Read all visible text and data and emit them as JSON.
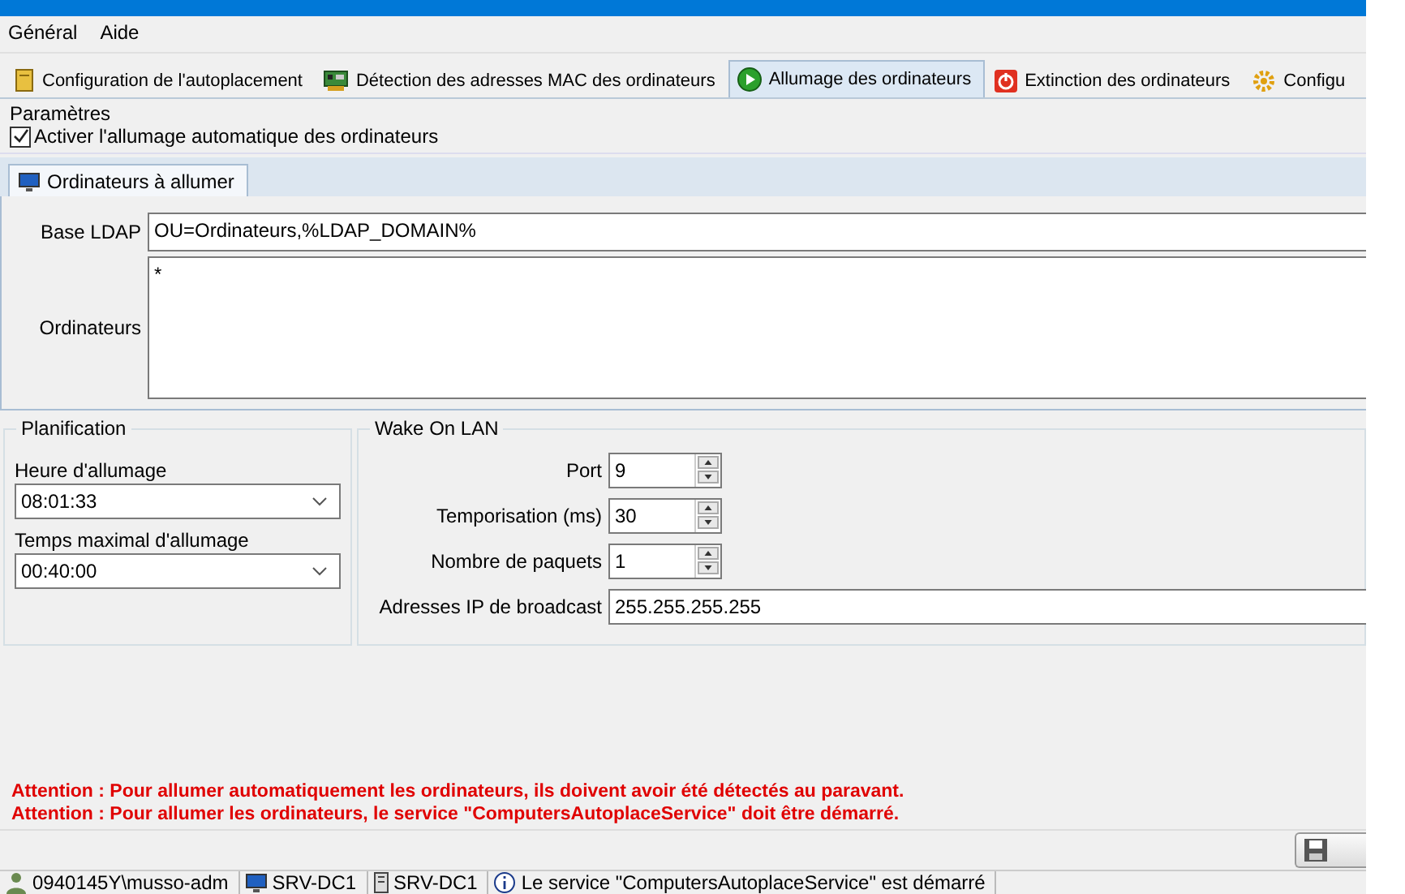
{
  "menu": [
    {
      "label": "Général"
    },
    {
      "label": "Aide"
    }
  ],
  "tabs": [
    {
      "label": "Configuration de l'autoplacement",
      "selected": false
    },
    {
      "label": "Détection des adresses MAC des ordinateurs",
      "selected": false
    },
    {
      "label": "Allumage des ordinateurs",
      "selected": true
    },
    {
      "label": "Extinction des ordinateurs",
      "selected": false
    },
    {
      "label": "Configu",
      "selected": false
    }
  ],
  "settings": {
    "title": "Paramètres",
    "auto_power_on": {
      "label": "Activer l'allumage automatique des ordinateurs",
      "checked": true
    }
  },
  "subtabs": [
    {
      "label": "Ordinateurs à allumer",
      "selected": true
    }
  ],
  "ldap": {
    "label": "Base LDAP",
    "value": "OU=Ordinateurs,%LDAP_DOMAIN%"
  },
  "computers": {
    "label": "Ordinateurs",
    "value": "*"
  },
  "planning": {
    "title": "Planification",
    "fields": [
      {
        "label": "Heure d'allumage",
        "value": "08:01:33"
      },
      {
        "label": "Temps maximal d'allumage",
        "value": "00:40:00"
      }
    ]
  },
  "wol": {
    "title": "Wake On LAN",
    "fields": [
      {
        "kind": "spin",
        "label": "Port",
        "value": "9"
      },
      {
        "kind": "spin",
        "label": "Temporisation (ms)",
        "value": "30"
      },
      {
        "kind": "spin",
        "label": "Nombre de paquets",
        "value": "1"
      },
      {
        "kind": "text",
        "label": "Adresses IP de broadcast",
        "value": "255.255.255.255"
      }
    ]
  },
  "warnings": [
    "Attention : Pour allumer automatiquement les ordinateurs, ils doivent avoir été détectés au paravant.",
    "Attention : Pour allumer les ordinateurs, le service \"ComputersAutoplaceService\" doit être démarré."
  ],
  "status_bar": [
    {
      "text": "0940145Y\\musso-adm"
    },
    {
      "text": "SRV-DC1"
    },
    {
      "text": "SRV-DC1"
    },
    {
      "text": "Le service \"ComputersAutoplaceService\" est démarré"
    }
  ]
}
